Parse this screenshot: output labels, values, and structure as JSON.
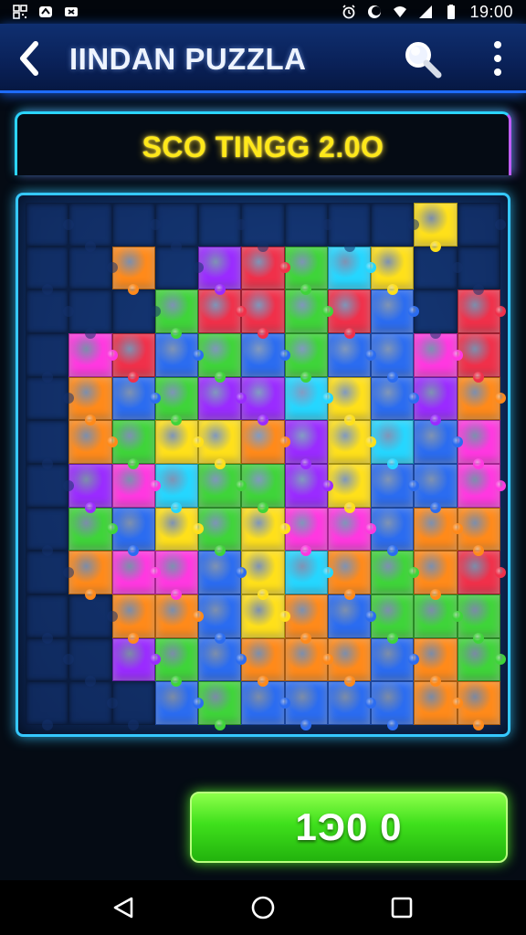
{
  "status_bar": {
    "time": "19:00",
    "left_icons": [
      "qr-icon",
      "app-notification-icon",
      "message-icon"
    ],
    "right_icons": [
      "alarm-icon",
      "do-not-disturb-icon",
      "wifi-icon",
      "signal-icon",
      "battery-icon"
    ]
  },
  "app_bar": {
    "title": "IINDAN PUZZLA",
    "back_icon": "chevron-left-icon",
    "search_icon": "search-icon",
    "menu_icon": "more-vertical-icon"
  },
  "score": {
    "text": "SCO TINGG  2.0O"
  },
  "board": {
    "columns": 11,
    "rows": 12,
    "palette": {
      "R": "#f0304a",
      "O": "#ff8a1a",
      "Y": "#ffe01a",
      "G": "#3fd43a",
      "C": "#25d6ff",
      "B": "#2b6cf0",
      "P": "#9a2bff",
      "M": "#ff38e0",
      "D": "#1f3f85",
      "E": "#183a7a"
    },
    "pieces": [
      "EEEEEEEEEYE",
      "EEOEPRGCYEEM",
      "EEEGRRGRBERM",
      "EMRBGBGBBMRB",
      "EOBGPPCYBPOB",
      "EOGYYOPYCBMB",
      "EPMCGGPYBBMB",
      "EGBYGYMMBOOB",
      "EOMMBYCOGORB",
      "EEOOBYOBGGGB",
      "EEPGBOOOBOGE",
      "EEEBGBBBBOOM"
    ]
  },
  "action_button": {
    "label": "1Ͽ0 0"
  },
  "nav_bar": {
    "back_icon": "triangle-back-icon",
    "home_icon": "circle-home-icon",
    "recents_icon": "square-recents-icon"
  }
}
